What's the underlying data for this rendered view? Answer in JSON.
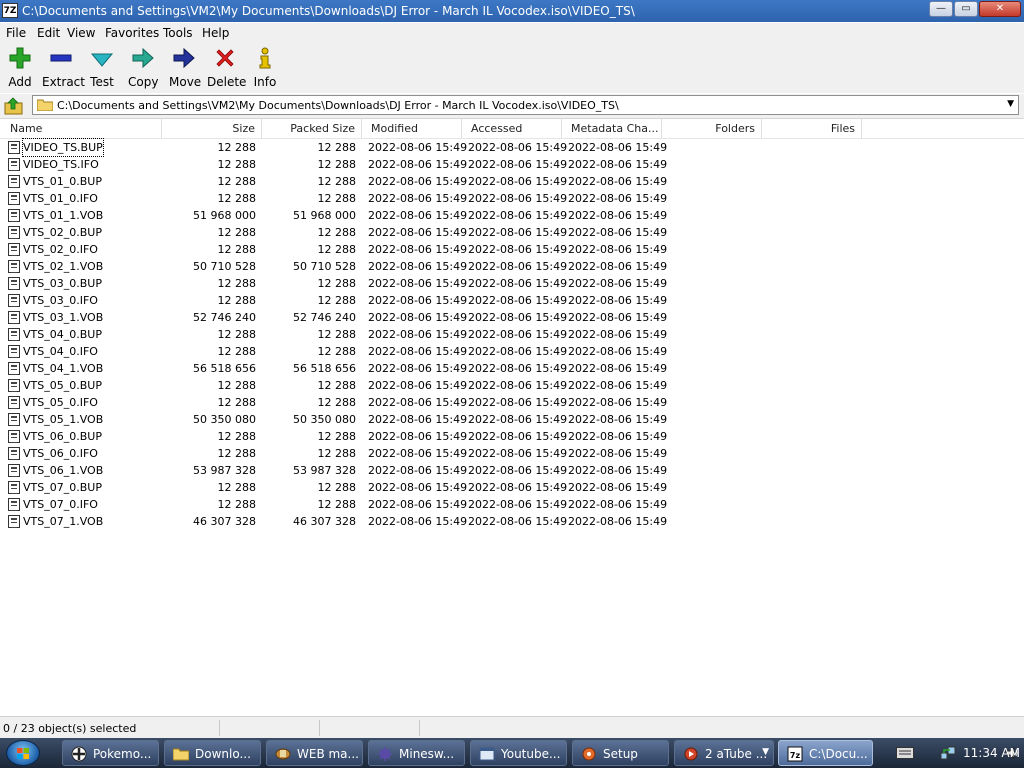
{
  "window": {
    "title": "C:\\Documents and Settings\\VM2\\My Documents\\Downloads\\DJ Error - March IL Vocodex.iso\\VIDEO_TS\\",
    "app_icon_text": "7Z"
  },
  "menu": [
    "File",
    "Edit",
    "View",
    "Favorites",
    "Tools",
    "Help"
  ],
  "toolbar": [
    {
      "label": "Add",
      "icon": "plus-icon",
      "color": "#1a9a1a"
    },
    {
      "label": "Extract",
      "icon": "minus-icon",
      "color": "#1e2fb3"
    },
    {
      "label": "Test",
      "icon": "check-arrow-icon",
      "color": "#1aa3a3"
    },
    {
      "label": "Copy",
      "icon": "double-arrow-icon",
      "color": "#1aa38c"
    },
    {
      "label": "Move",
      "icon": "arrow-right-icon",
      "color": "#1e2f8a"
    },
    {
      "label": "Delete",
      "icon": "x-icon",
      "color": "#d01a1a"
    },
    {
      "label": "Info",
      "icon": "info-icon",
      "color": "#d0b000"
    }
  ],
  "address": {
    "path": "C:\\Documents and Settings\\VM2\\My Documents\\Downloads\\DJ Error - March IL Vocodex.iso\\VIDEO_TS\\"
  },
  "columns": [
    "Name",
    "Size",
    "Packed Size",
    "Modified",
    "Accessed",
    "Metadata Cha...",
    "Folders",
    "Files"
  ],
  "files": [
    {
      "name": "VIDEO_TS.BUP",
      "size": "12 288",
      "packed": "12 288",
      "modified": "2022-08-06 15:49",
      "accessed": "2022-08-06 15:49",
      "metadata": "2022-08-06 15:49"
    },
    {
      "name": "VIDEO_TS.IFO",
      "size": "12 288",
      "packed": "12 288",
      "modified": "2022-08-06 15:49",
      "accessed": "2022-08-06 15:49",
      "metadata": "2022-08-06 15:49"
    },
    {
      "name": "VTS_01_0.BUP",
      "size": "12 288",
      "packed": "12 288",
      "modified": "2022-08-06 15:49",
      "accessed": "2022-08-06 15:49",
      "metadata": "2022-08-06 15:49"
    },
    {
      "name": "VTS_01_0.IFO",
      "size": "12 288",
      "packed": "12 288",
      "modified": "2022-08-06 15:49",
      "accessed": "2022-08-06 15:49",
      "metadata": "2022-08-06 15:49"
    },
    {
      "name": "VTS_01_1.VOB",
      "size": "51 968 000",
      "packed": "51 968 000",
      "modified": "2022-08-06 15:49",
      "accessed": "2022-08-06 15:49",
      "metadata": "2022-08-06 15:49"
    },
    {
      "name": "VTS_02_0.BUP",
      "size": "12 288",
      "packed": "12 288",
      "modified": "2022-08-06 15:49",
      "accessed": "2022-08-06 15:49",
      "metadata": "2022-08-06 15:49"
    },
    {
      "name": "VTS_02_0.IFO",
      "size": "12 288",
      "packed": "12 288",
      "modified": "2022-08-06 15:49",
      "accessed": "2022-08-06 15:49",
      "metadata": "2022-08-06 15:49"
    },
    {
      "name": "VTS_02_1.VOB",
      "size": "50 710 528",
      "packed": "50 710 528",
      "modified": "2022-08-06 15:49",
      "accessed": "2022-08-06 15:49",
      "metadata": "2022-08-06 15:49"
    },
    {
      "name": "VTS_03_0.BUP",
      "size": "12 288",
      "packed": "12 288",
      "modified": "2022-08-06 15:49",
      "accessed": "2022-08-06 15:49",
      "metadata": "2022-08-06 15:49"
    },
    {
      "name": "VTS_03_0.IFO",
      "size": "12 288",
      "packed": "12 288",
      "modified": "2022-08-06 15:49",
      "accessed": "2022-08-06 15:49",
      "metadata": "2022-08-06 15:49"
    },
    {
      "name": "VTS_03_1.VOB",
      "size": "52 746 240",
      "packed": "52 746 240",
      "modified": "2022-08-06 15:49",
      "accessed": "2022-08-06 15:49",
      "metadata": "2022-08-06 15:49"
    },
    {
      "name": "VTS_04_0.BUP",
      "size": "12 288",
      "packed": "12 288",
      "modified": "2022-08-06 15:49",
      "accessed": "2022-08-06 15:49",
      "metadata": "2022-08-06 15:49"
    },
    {
      "name": "VTS_04_0.IFO",
      "size": "12 288",
      "packed": "12 288",
      "modified": "2022-08-06 15:49",
      "accessed": "2022-08-06 15:49",
      "metadata": "2022-08-06 15:49"
    },
    {
      "name": "VTS_04_1.VOB",
      "size": "56 518 656",
      "packed": "56 518 656",
      "modified": "2022-08-06 15:49",
      "accessed": "2022-08-06 15:49",
      "metadata": "2022-08-06 15:49"
    },
    {
      "name": "VTS_05_0.BUP",
      "size": "12 288",
      "packed": "12 288",
      "modified": "2022-08-06 15:49",
      "accessed": "2022-08-06 15:49",
      "metadata": "2022-08-06 15:49"
    },
    {
      "name": "VTS_05_0.IFO",
      "size": "12 288",
      "packed": "12 288",
      "modified": "2022-08-06 15:49",
      "accessed": "2022-08-06 15:49",
      "metadata": "2022-08-06 15:49"
    },
    {
      "name": "VTS_05_1.VOB",
      "size": "50 350 080",
      "packed": "50 350 080",
      "modified": "2022-08-06 15:49",
      "accessed": "2022-08-06 15:49",
      "metadata": "2022-08-06 15:49"
    },
    {
      "name": "VTS_06_0.BUP",
      "size": "12 288",
      "packed": "12 288",
      "modified": "2022-08-06 15:49",
      "accessed": "2022-08-06 15:49",
      "metadata": "2022-08-06 15:49"
    },
    {
      "name": "VTS_06_0.IFO",
      "size": "12 288",
      "packed": "12 288",
      "modified": "2022-08-06 15:49",
      "accessed": "2022-08-06 15:49",
      "metadata": "2022-08-06 15:49"
    },
    {
      "name": "VTS_06_1.VOB",
      "size": "53 987 328",
      "packed": "53 987 328",
      "modified": "2022-08-06 15:49",
      "accessed": "2022-08-06 15:49",
      "metadata": "2022-08-06 15:49"
    },
    {
      "name": "VTS_07_0.BUP",
      "size": "12 288",
      "packed": "12 288",
      "modified": "2022-08-06 15:49",
      "accessed": "2022-08-06 15:49",
      "metadata": "2022-08-06 15:49"
    },
    {
      "name": "VTS_07_0.IFO",
      "size": "12 288",
      "packed": "12 288",
      "modified": "2022-08-06 15:49",
      "accessed": "2022-08-06 15:49",
      "metadata": "2022-08-06 15:49"
    },
    {
      "name": "VTS_07_1.VOB",
      "size": "46 307 328",
      "packed": "46 307 328",
      "modified": "2022-08-06 15:49",
      "accessed": "2022-08-06 15:49",
      "metadata": "2022-08-06 15:49"
    }
  ],
  "status": {
    "selection": "0 / 23 object(s) selected"
  },
  "taskbar": {
    "tasks": [
      {
        "label": "Pokemo...",
        "icon": "pokeball-icon"
      },
      {
        "label": "Downlo...",
        "icon": "folder-icon"
      },
      {
        "label": "WEB ma...",
        "icon": "app-icon"
      },
      {
        "label": "Minesw...",
        "icon": "mine-icon"
      },
      {
        "label": "Youtube...",
        "icon": "window-icon"
      },
      {
        "label": "Setup",
        "icon": "setup-icon"
      },
      {
        "label": "2 aTube ...",
        "icon": "atube-icon"
      },
      {
        "label": "C:\\Docu...",
        "icon": "7zip-icon"
      }
    ],
    "clock": "11:34 AM"
  }
}
